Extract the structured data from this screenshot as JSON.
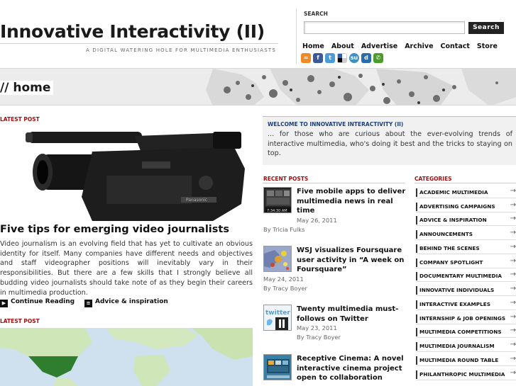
{
  "header": {
    "site_title": "Innovative Interactivity (II)",
    "tagline": "A DIGITAL WATERING HOLE FOR MULTIMEDIA ENTHUSIASTS"
  },
  "search": {
    "label": "SEARCH",
    "placeholder": "",
    "button": "Search"
  },
  "nav": [
    "Home",
    "About",
    "Advertise",
    "Archive",
    "Contact",
    "Store"
  ],
  "social_icons": [
    {
      "name": "rss-icon",
      "color": "#f08a24",
      "glyph": "r"
    },
    {
      "name": "facebook-icon",
      "color": "#3b5998",
      "glyph": "f"
    },
    {
      "name": "twitter-icon",
      "color": "#4a9bd6",
      "glyph": "t"
    },
    {
      "name": "delicious-icon",
      "color": "#2a5db0",
      "glyph": "d"
    },
    {
      "name": "stumbleupon-icon",
      "color": "#3f8fc2",
      "glyph": "s"
    },
    {
      "name": "digg-icon",
      "color": "#2a6bab",
      "glyph": "d"
    },
    {
      "name": "chat-icon",
      "color": "#4a9b2a",
      "glyph": "c"
    }
  ],
  "page_heading": "// home",
  "latest_post": {
    "label": "LATEST POST",
    "title": "Five tips for emerging video journalists",
    "excerpt": "Video journalism is an evolving field that has yet to cultivate an obvious identity for itself. Many companies have different needs and objectives and staff videographer positions will inevitably vary in their responsibilities. But there are a few skills that I strongly believe all budding video journalists should take note of as they begin their careers in multimedia production.",
    "continue": "Continue Reading",
    "category": "Advice & inspiration"
  },
  "latest_post_2": {
    "label": "LATEST POST"
  },
  "welcome": {
    "title": "WELCOME TO INNOVATIVE INTERACTIVITY (II)",
    "text": "... for those who are curious about the ever-evolving trends of interactive multimedia, who's doing it best and the tricks to staying on top."
  },
  "recent": {
    "label": "RECENT POSTS",
    "items": [
      {
        "title": "Five mobile apps to deliver multimedia news in real time",
        "date": "May 26, 2011",
        "author": "By Tricia Fulks",
        "thumb_text": "7:34:30 AM"
      },
      {
        "title": "WSJ visualizes Foursquare user activity in “A week on Foursquare”",
        "date": "May 24, 2011",
        "author": "By Tracy Boyer",
        "thumb_text": ""
      },
      {
        "title": "Twenty multimedia must-follows on Twitter",
        "date": "May 23, 2011",
        "author": "By Tracy Boyer",
        "thumb_text": "twitter"
      },
      {
        "title": "Receptive Cinema: A novel interactive cinema project open to collaboration",
        "date": "",
        "author": "",
        "thumb_text": ""
      }
    ]
  },
  "categories": {
    "label": "CATEGORIES",
    "items": [
      "ACADEMIC MULTIMEDIA",
      "ADVERTISING CAMPAIGNS",
      "ADVICE & INSPIRATION",
      "ANNOUNCEMENTS",
      "BEHIND THE SCENES",
      "COMPANY SPOTLIGHT",
      "DOCUMENTARY MULTIMEDIA",
      "INNOVATIVE INDIVIDUALS",
      "INTERACTIVE EXAMPLES",
      "INTERNSHIP & JOB OPENINGS",
      "MULTIMEDIA COMPETITIONS",
      "MULTIMEDIA JOURNALISM",
      "MULTIMEDIA ROUND TABLE",
      "PHILANTHROPIC MULTIMEDIA"
    ]
  },
  "colors": {
    "section_label": "#a01010",
    "welcome_title": "#1b3f7a"
  }
}
